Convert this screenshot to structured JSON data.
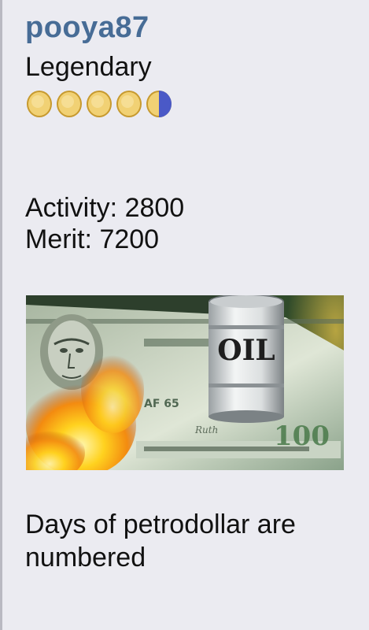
{
  "profile": {
    "username": "pooya87",
    "rank": "Legendary",
    "coins": {
      "full": 4,
      "half": 1,
      "coin_color": "#e7c15e",
      "half_color": "#4a59c7"
    },
    "activity_line": "Activity: 2800",
    "merit_line": "Merit: 7200",
    "avatar": {
      "text": "OIL",
      "icon": "burning-dollar-oil-barrel-image"
    },
    "signature": "Days of petrodollar are numbered"
  }
}
